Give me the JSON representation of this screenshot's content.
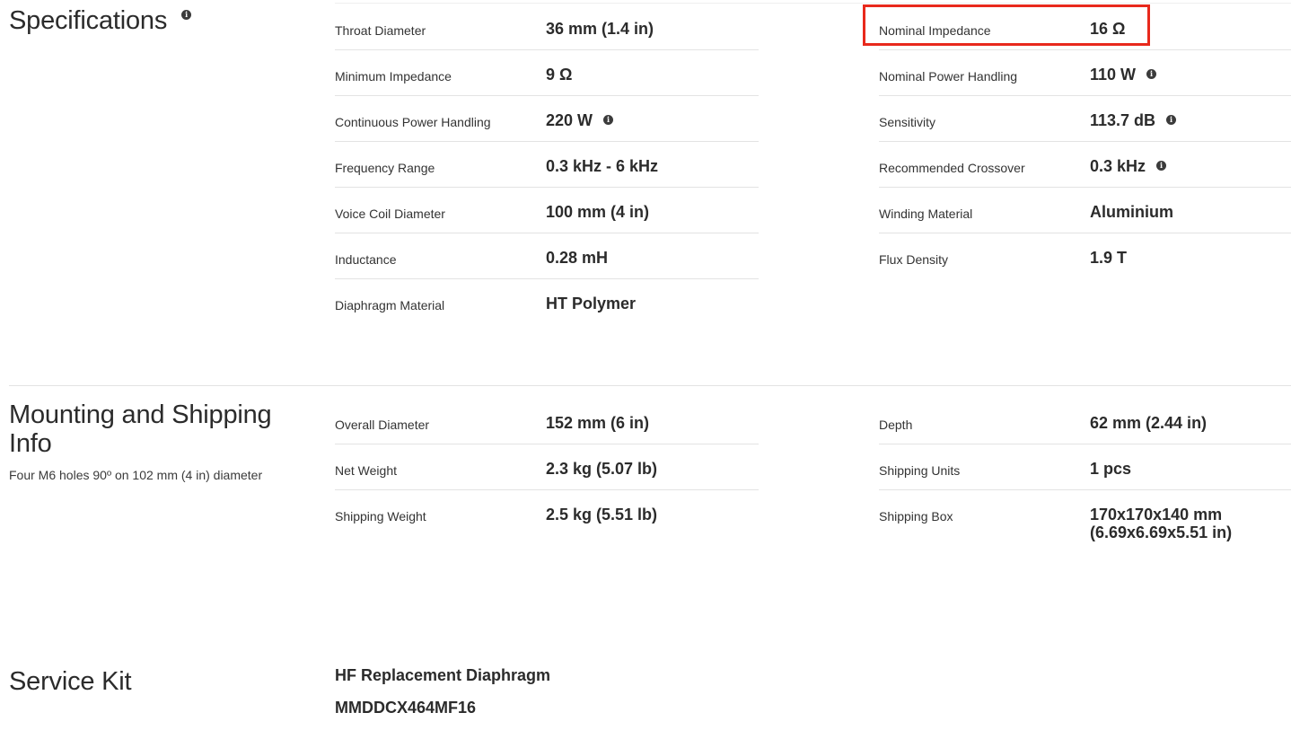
{
  "specifications": {
    "title": "Specifications",
    "left_rows": [
      {
        "label": "Throat Diameter",
        "value": "36 mm (1.4 in)",
        "info": false
      },
      {
        "label": "Minimum Impedance",
        "value": "9 Ω",
        "info": false
      },
      {
        "label": "Continuous Power Handling",
        "value": "220 W",
        "info": true
      },
      {
        "label": "Frequency Range",
        "value": "0.3 kHz - 6 kHz",
        "info": false
      },
      {
        "label": "Voice Coil Diameter",
        "value": "100 mm (4 in)",
        "info": false
      },
      {
        "label": "Inductance",
        "value": "0.28 mH",
        "info": false
      },
      {
        "label": "Diaphragm Material",
        "value": "HT Polymer",
        "info": false
      }
    ],
    "right_rows": [
      {
        "label": "Nominal Impedance",
        "value": "16 Ω",
        "info": false
      },
      {
        "label": "Nominal Power Handling",
        "value": "110 W",
        "info": true
      },
      {
        "label": "Sensitivity",
        "value": "113.7 dB",
        "info": true
      },
      {
        "label": "Recommended Crossover",
        "value": "0.3 kHz",
        "info": true
      },
      {
        "label": "Winding Material",
        "value": "Aluminium",
        "info": false
      },
      {
        "label": "Flux Density",
        "value": "1.9 T",
        "info": false
      }
    ]
  },
  "mounting": {
    "title_line1": "Mounting and Shipping",
    "title_line2": "Info",
    "note": "Four M6 holes 90º on 102 mm (4 in) diameter",
    "left_rows": [
      {
        "label": "Overall Diameter",
        "value": "152 mm (6 in)"
      },
      {
        "label": "Net Weight",
        "value": "2.3 kg (5.07 lb)"
      },
      {
        "label": "Shipping Weight",
        "value": "2.5 kg (5.51 lb)"
      }
    ],
    "right_rows": [
      {
        "label": "Depth",
        "value": "62 mm (2.44 in)"
      },
      {
        "label": "Shipping Units",
        "value": "1 pcs"
      },
      {
        "label": "Shipping Box",
        "value_line1": "170x170x140 mm",
        "value_line2": "(6.69x6.69x5.51 in)"
      }
    ]
  },
  "service_kit": {
    "title": "Service Kit",
    "name": "HF Replacement Diaphragm",
    "code": "MMDDCX464MF16"
  },
  "icons": {
    "info": "info-icon"
  },
  "colors": {
    "highlight": "#e8291c",
    "text": "#2b2b2b",
    "divider": "#e3e3e3"
  }
}
